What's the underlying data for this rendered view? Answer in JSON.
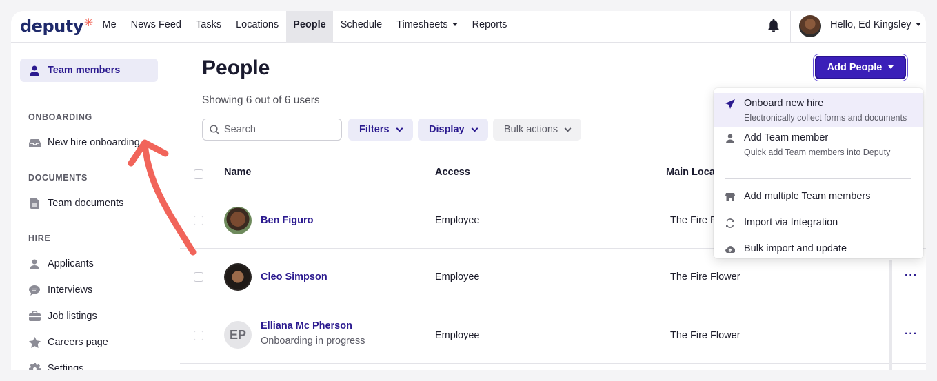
{
  "app": {
    "logo": "deputy"
  },
  "nav": {
    "links": [
      "Me",
      "News Feed",
      "Tasks",
      "Locations",
      "People",
      "Schedule",
      "Timesheets",
      "Reports"
    ],
    "active": "People",
    "user_greeting": "Hello, Ed Kingsley"
  },
  "sidebar": {
    "team_members": "Team members",
    "onboarding_heading": "ONBOARDING",
    "new_hire_onboarding": "New hire onboarding",
    "documents_heading": "DOCUMENTS",
    "team_documents": "Team documents",
    "hire_heading": "HIRE",
    "hire_items": [
      "Applicants",
      "Interviews",
      "Job listings",
      "Careers page",
      "Settings"
    ]
  },
  "main": {
    "title": "People",
    "showing": "Showing 6 out of 6 users",
    "search_placeholder": "Search",
    "filters_label": "Filters",
    "display_label": "Display",
    "bulk_actions_label": "Bulk actions",
    "add_people_label": "Add People"
  },
  "table": {
    "columns": [
      "Name",
      "Access",
      "Main Loca"
    ],
    "rows": [
      {
        "name": "Ben Figuro",
        "sub": "",
        "access": "Employee",
        "location": "The Fire F",
        "initials": ""
      },
      {
        "name": "Cleo Simpson",
        "sub": "",
        "access": "Employee",
        "location": "The Fire Flower",
        "initials": ""
      },
      {
        "name": "Elliana Mc Pherson",
        "sub": "Onboarding in progress",
        "access": "Employee",
        "location": "The Fire Flower",
        "initials": "EP"
      }
    ],
    "more_glyph": "···"
  },
  "dropdown": {
    "onboard_title": "Onboard new hire",
    "onboard_sub": "Electronically collect forms and documents",
    "add_member_title": "Add Team member",
    "add_member_sub": "Quick add Team members into Deputy",
    "add_multiple": "Add multiple Team members",
    "import_integration": "Import via Integration",
    "bulk_import": "Bulk import and update"
  },
  "colors": {
    "brand": "#2b1a8f",
    "accent_button": "#3a1fb8",
    "annotation_arrow": "#f1645a"
  }
}
